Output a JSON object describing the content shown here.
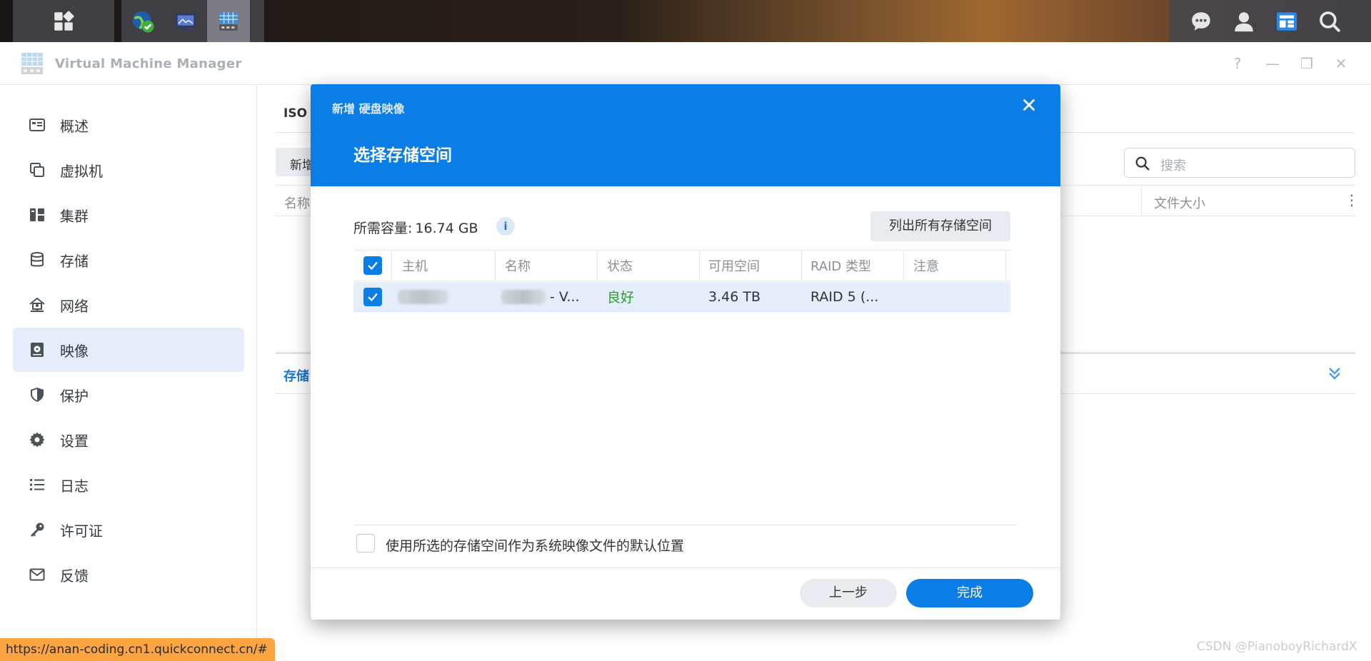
{
  "app": {
    "title": "Virtual Machine Manager",
    "controls": {
      "help": "?",
      "minimize": "—",
      "restore": "❐",
      "close": "✕"
    }
  },
  "taskbar": {
    "left_icons": [
      "apps-grid-icon",
      "globe-shield-icon",
      "monitor-icon",
      "vmm-icon"
    ],
    "right_icons": [
      "chat-icon",
      "user-icon",
      "widgets-icon",
      "search-icon"
    ]
  },
  "sidebar": {
    "items": [
      {
        "label": "概述",
        "icon": "overview-icon",
        "active": false
      },
      {
        "label": "虚拟机",
        "icon": "vm-icon",
        "active": false
      },
      {
        "label": "集群",
        "icon": "cluster-icon",
        "active": false
      },
      {
        "label": "存储",
        "icon": "storage-icon",
        "active": false
      },
      {
        "label": "网络",
        "icon": "network-icon",
        "active": false
      },
      {
        "label": "映像",
        "icon": "image-icon",
        "active": true
      },
      {
        "label": "保护",
        "icon": "shield-icon",
        "active": false
      },
      {
        "label": "设置",
        "icon": "gear-icon",
        "active": false
      },
      {
        "label": "日志",
        "icon": "log-list-icon",
        "active": false
      },
      {
        "label": "许可证",
        "icon": "key-icon",
        "active": false
      },
      {
        "label": "反馈",
        "icon": "mail-icon",
        "active": false
      }
    ]
  },
  "main": {
    "tab": "ISO",
    "new_button": "新增",
    "search_placeholder": "搜索",
    "columns": [
      "名称",
      "文件大小"
    ],
    "lower_tab": "存储"
  },
  "modal": {
    "title": "新增 硬盘映像",
    "step_title": "选择存储空间",
    "required_label": "所需容量:",
    "required_value": "16.74 GB",
    "list_all_button": "列出所有存储空间",
    "columns": [
      "主机",
      "名称",
      "状态",
      "可用空间",
      "RAID 类型",
      "注意"
    ],
    "rows": [
      {
        "host": "",
        "name": "- V...",
        "status": "良好",
        "free_space": "3.46 TB",
        "raid": "RAID 5 (...",
        "note": "",
        "checked": true
      }
    ],
    "default_checkbox_label": "使用所选的存储空间作为系统映像文件的默认位置",
    "back_button": "上一步",
    "finish_button": "完成"
  },
  "status_url": "https://anan-coding.cn1.quickconnect.cn/#",
  "watermark": "CSDN @PianoboyRichardX",
  "colors": {
    "accent": "#0a7de6",
    "status_good": "#2e9b2e",
    "url_bar": "#fba440"
  }
}
